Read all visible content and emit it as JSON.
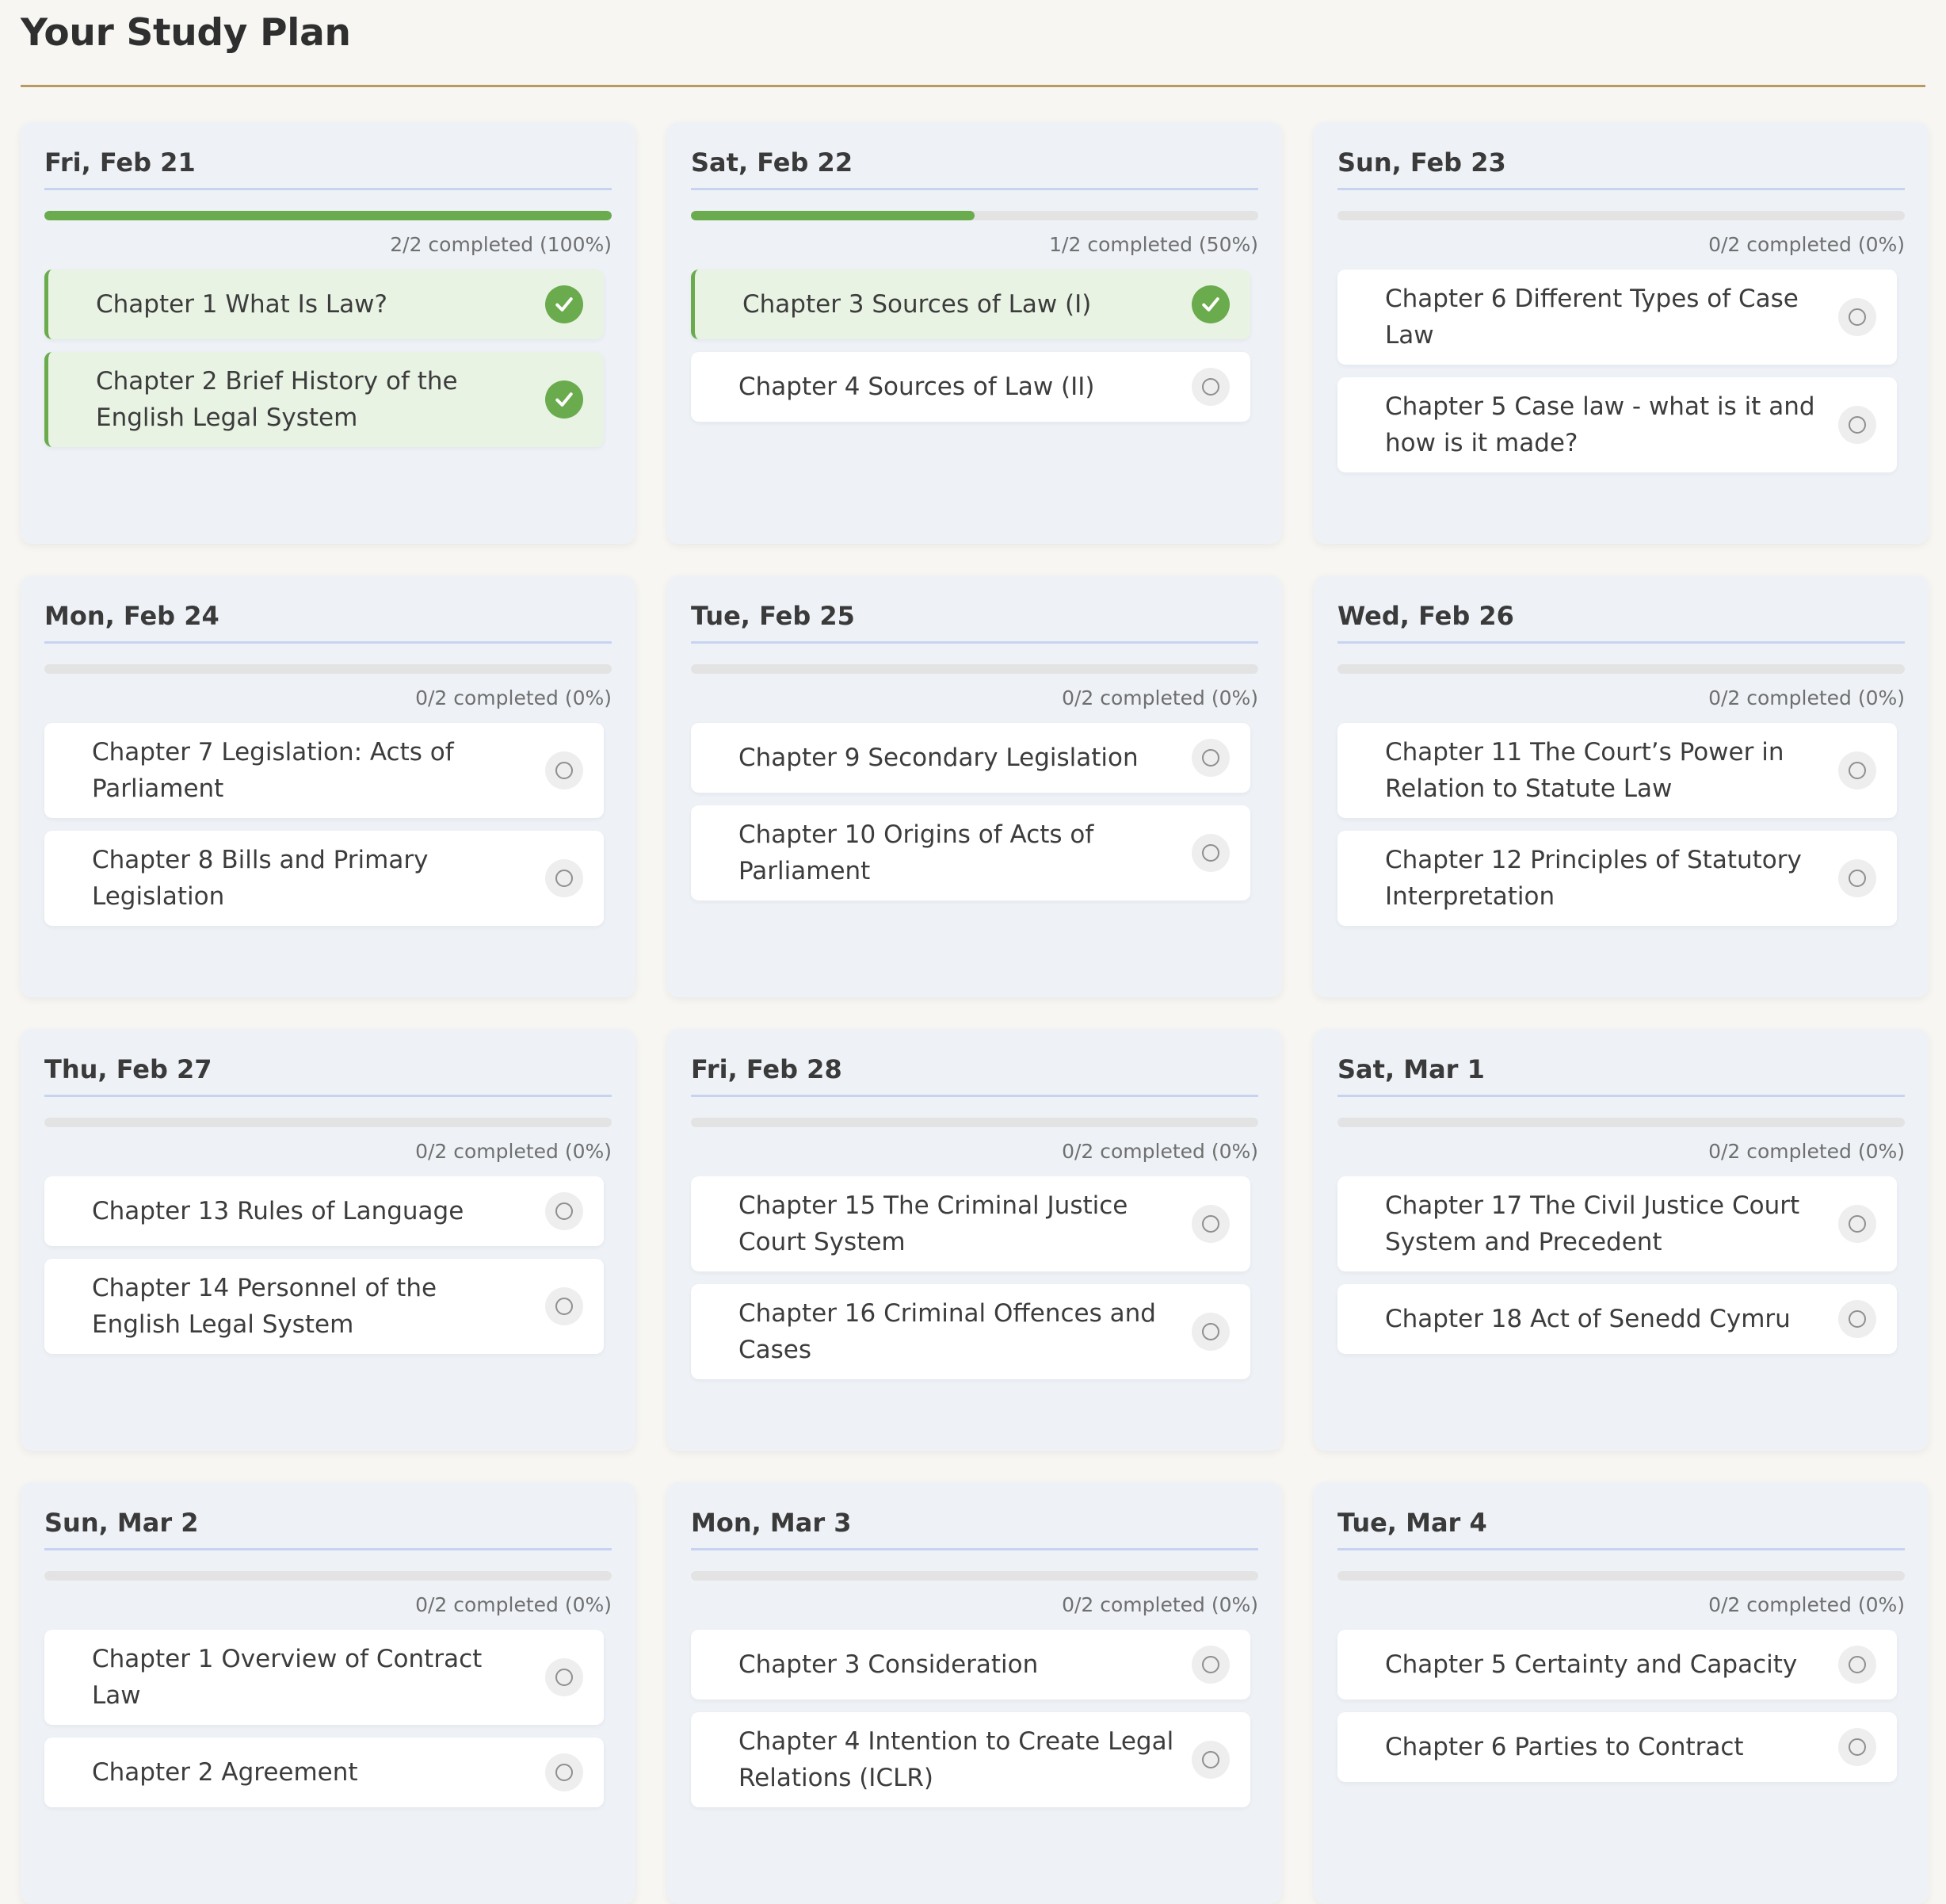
{
  "page": {
    "title": "Your Study Plan"
  },
  "colors": {
    "accent_line": "#b89b63",
    "success": "#6aab4d",
    "card_bg": "#eef2f7",
    "day_underline": "#c7d3f1"
  },
  "days": [
    {
      "date": "Fri, Feb 21",
      "progress_fraction": 1.0,
      "progress_text": "2/2 completed (100%)",
      "tasks": [
        {
          "label": "Chapter 1 What Is Law?",
          "completed": true
        },
        {
          "label": "Chapter 2 Brief History of the English Legal System",
          "completed": true
        }
      ]
    },
    {
      "date": "Sat, Feb 22",
      "progress_fraction": 0.5,
      "progress_text": "1/2 completed (50%)",
      "tasks": [
        {
          "label": "Chapter 3 Sources of Law (I)",
          "completed": true
        },
        {
          "label": "Chapter 4 Sources of Law (II)",
          "completed": false
        }
      ]
    },
    {
      "date": "Sun, Feb 23",
      "progress_fraction": 0,
      "progress_text": "0/2 completed (0%)",
      "tasks": [
        {
          "label": "Chapter 6 Different Types of Case Law",
          "completed": false
        },
        {
          "label": "Chapter 5 Case law - what is it and how is it made?",
          "completed": false
        }
      ]
    },
    {
      "date": "Mon, Feb 24",
      "progress_fraction": 0,
      "progress_text": "0/2 completed (0%)",
      "tasks": [
        {
          "label": "Chapter 7 Legislation: Acts of Parliament",
          "completed": false
        },
        {
          "label": "Chapter 8 Bills and Primary Legislation",
          "completed": false
        }
      ]
    },
    {
      "date": "Tue, Feb 25",
      "progress_fraction": 0,
      "progress_text": "0/2 completed (0%)",
      "tasks": [
        {
          "label": "Chapter 9 Secondary Legislation",
          "completed": false
        },
        {
          "label": "Chapter 10 Origins of Acts of Parliament",
          "completed": false
        }
      ]
    },
    {
      "date": "Wed, Feb 26",
      "progress_fraction": 0,
      "progress_text": "0/2 completed (0%)",
      "tasks": [
        {
          "label": "Chapter 11 The Court’s Power in Relation to Statute Law",
          "completed": false
        },
        {
          "label": "Chapter 12 Principles of Statutory Interpretation",
          "completed": false
        }
      ]
    },
    {
      "date": "Thu, Feb 27",
      "progress_fraction": 0,
      "progress_text": "0/2 completed (0%)",
      "tasks": [
        {
          "label": "Chapter 13 Rules of Language",
          "completed": false
        },
        {
          "label": "Chapter 14 Personnel of the English Legal System",
          "completed": false
        }
      ]
    },
    {
      "date": "Fri, Feb 28",
      "progress_fraction": 0,
      "progress_text": "0/2 completed (0%)",
      "tasks": [
        {
          "label": "Chapter 15 The Criminal Justice Court System",
          "completed": false
        },
        {
          "label": "Chapter 16 Criminal Offences and Cases",
          "completed": false
        }
      ]
    },
    {
      "date": "Sat, Mar 1",
      "progress_fraction": 0,
      "progress_text": "0/2 completed (0%)",
      "tasks": [
        {
          "label": "Chapter 17 The Civil Justice Court System and Precedent",
          "completed": false
        },
        {
          "label": "Chapter 18 Act of Senedd Cymru",
          "completed": false
        }
      ]
    },
    {
      "date": "Sun, Mar 2",
      "progress_fraction": 0,
      "progress_text": "0/2 completed (0%)",
      "tasks": [
        {
          "label": "Chapter 1 Overview of Contract Law",
          "completed": false
        },
        {
          "label": "Chapter 2 Agreement",
          "completed": false
        }
      ]
    },
    {
      "date": "Mon, Mar 3",
      "progress_fraction": 0,
      "progress_text": "0/2 completed (0%)",
      "tasks": [
        {
          "label": "Chapter 3 Consideration",
          "completed": false
        },
        {
          "label": "Chapter 4 Intention to Create Legal Relations (ICLR)",
          "completed": false
        }
      ]
    },
    {
      "date": "Tue, Mar 4",
      "progress_fraction": 0,
      "progress_text": "0/2 completed (0%)",
      "tasks": [
        {
          "label": "Chapter 5 Certainty and Capacity",
          "completed": false
        },
        {
          "label": "Chapter 6 Parties to Contract",
          "completed": false
        }
      ]
    }
  ]
}
